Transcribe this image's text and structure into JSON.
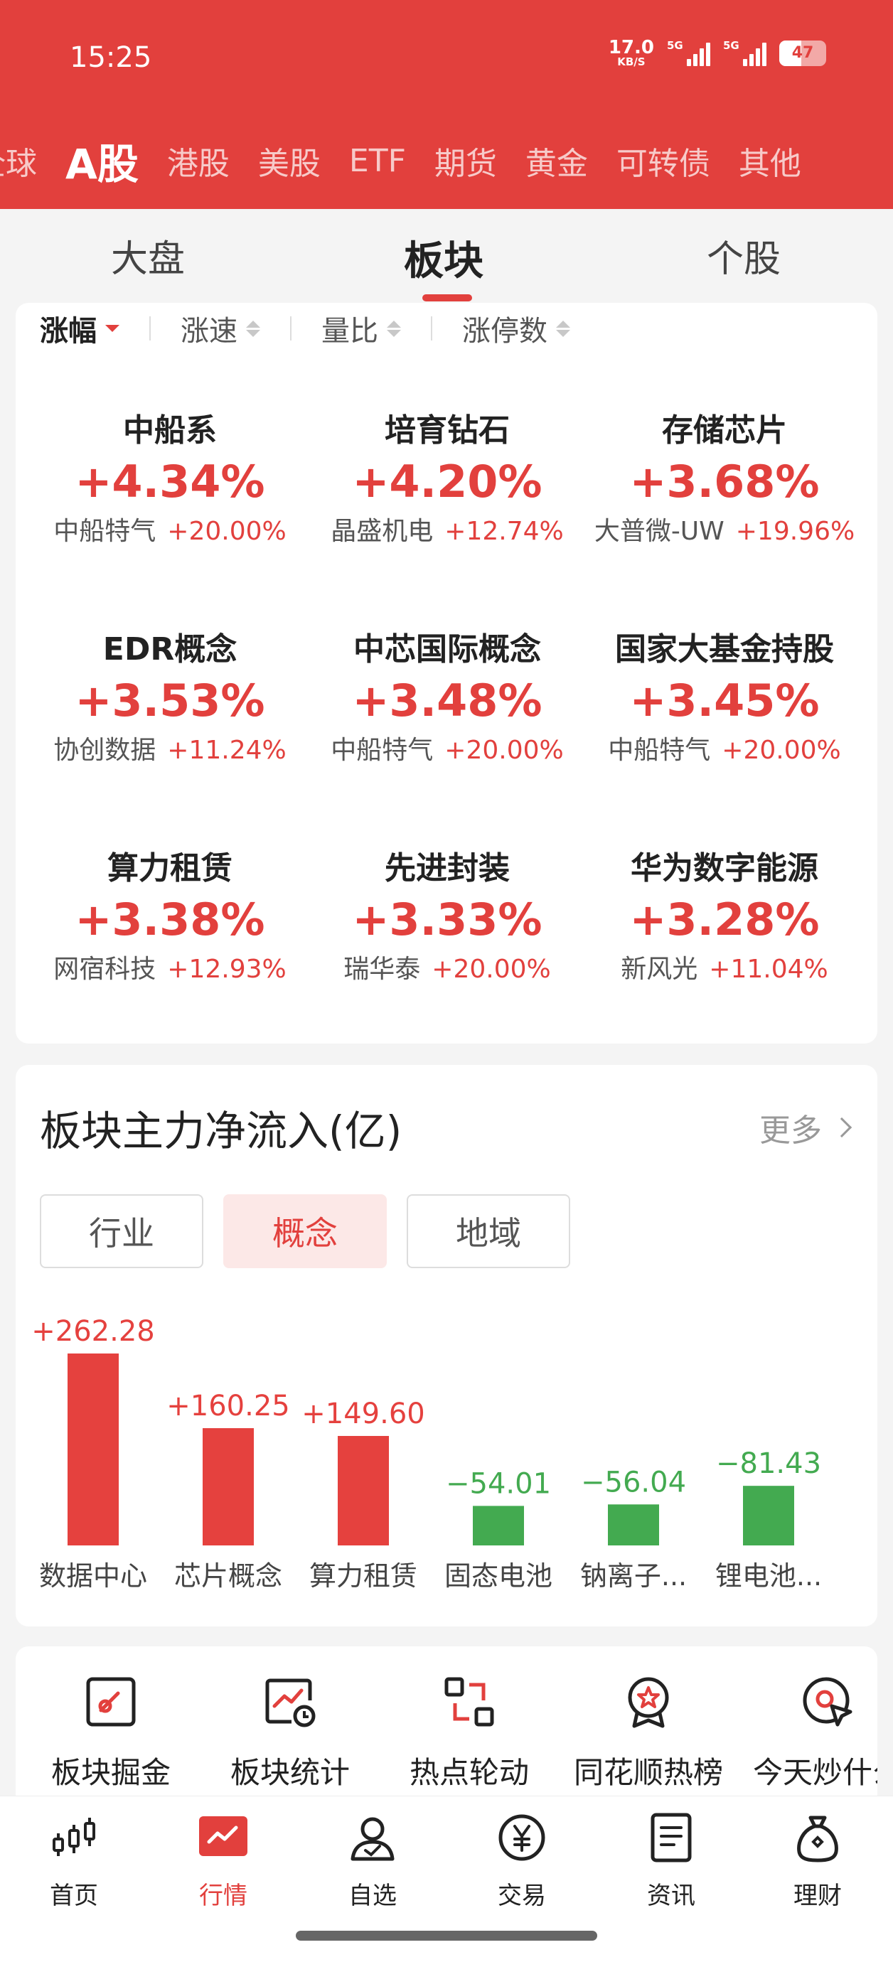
{
  "status_bar": {
    "time": "15:25",
    "net_speed": "17.0",
    "net_unit": "KB/S",
    "signal1": "5G",
    "signal2": "5G",
    "battery": "47"
  },
  "market_tabs": [
    "全球",
    "A股",
    "港股",
    "美股",
    "ETF",
    "期货",
    "黄金",
    "可转债",
    "其他"
  ],
  "sub_tabs": [
    "大盘",
    "板块",
    "个股"
  ],
  "sort_options": [
    "涨幅",
    "涨速",
    "量比",
    "涨停数"
  ],
  "sectors": [
    {
      "name": "中船系",
      "change": "+4.34%",
      "leader": "中船特气",
      "leader_change": "+20.00%"
    },
    {
      "name": "培育钻石",
      "change": "+4.20%",
      "leader": "晶盛机电",
      "leader_change": "+12.74%"
    },
    {
      "name": "存储芯片",
      "change": "+3.68%",
      "leader": "大普微-UW",
      "leader_change": "+19.96%"
    },
    {
      "name": "EDR概念",
      "change": "+3.53%",
      "leader": "协创数据",
      "leader_change": "+11.24%"
    },
    {
      "name": "中芯国际概念",
      "change": "+3.48%",
      "leader": "中船特气",
      "leader_change": "+20.00%"
    },
    {
      "name": "国家大基金持股",
      "change": "+3.45%",
      "leader": "中船特气",
      "leader_change": "+20.00%"
    },
    {
      "name": "算力租赁",
      "change": "+3.38%",
      "leader": "网宿科技",
      "leader_change": "+12.93%"
    },
    {
      "name": "先进封装",
      "change": "+3.33%",
      "leader": "瑞华泰",
      "leader_change": "+20.00%"
    },
    {
      "name": "华为数字能源",
      "change": "+3.28%",
      "leader": "新风光",
      "leader_change": "+11.04%"
    }
  ],
  "flow_section": {
    "title": "板块主力净流入(亿)",
    "more": "更多",
    "segments": [
      "行业",
      "概念",
      "地域"
    ],
    "selected_segment": "概念"
  },
  "chart_data": {
    "type": "bar",
    "title": "板块主力净流入(亿)",
    "categories": [
      "数据中心",
      "芯片概念",
      "算力租赁",
      "固态电池",
      "钠离子...",
      "锂电池..."
    ],
    "values": [
      262.28,
      160.25,
      149.6,
      -54.01,
      -56.04,
      -81.43
    ],
    "value_labels": [
      "+262.28",
      "+160.25",
      "+149.60",
      "−54.01",
      "−56.04",
      "−81.43"
    ],
    "colors": {
      "positive": "#e5413e",
      "negative": "#43aa50"
    }
  },
  "tools": [
    "板块掘金",
    "板块统计",
    "热点轮动",
    "同花顺热榜",
    "今天炒什么"
  ],
  "bottom_nav": [
    "首页",
    "行情",
    "自选",
    "交易",
    "资讯",
    "理财"
  ],
  "active_nav": "行情",
  "colors": {
    "brand_red": "#e2403d",
    "up": "#e2403d",
    "down": "#43aa50"
  }
}
